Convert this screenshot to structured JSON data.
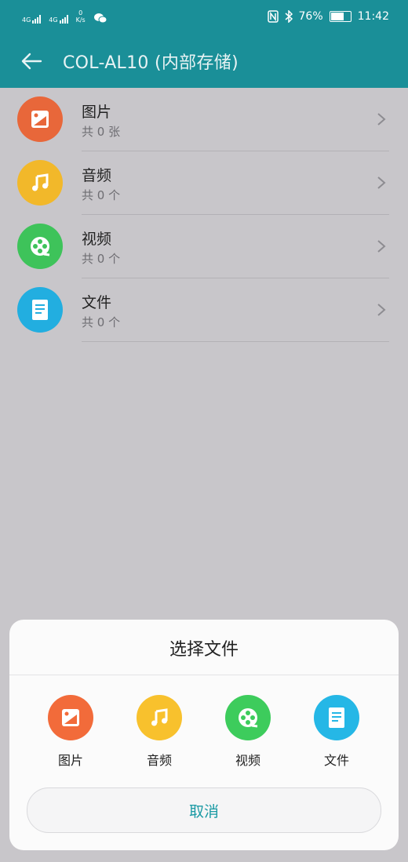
{
  "status_bar": {
    "signal1_label": "4G",
    "signal2_label": "4G",
    "net_speed_value": "0",
    "net_speed_unit": "K/s",
    "battery_percent": 76,
    "battery_text": "76%",
    "time": "11:42"
  },
  "app_bar": {
    "title": "COL-AL10 (内部存储)"
  },
  "list": {
    "items": [
      {
        "title": "图片",
        "subtitle": "共 0 张",
        "icon": "image-icon",
        "color": "#e8673a"
      },
      {
        "title": "音频",
        "subtitle": "共 0 个",
        "icon": "music-icon",
        "color": "#f2b82a"
      },
      {
        "title": "视频",
        "subtitle": "共 0 个",
        "icon": "video-icon",
        "color": "#3ec35a"
      },
      {
        "title": "文件",
        "subtitle": "共 0 个",
        "icon": "document-icon",
        "color": "#22aee0"
      }
    ]
  },
  "sheet": {
    "title": "选择文件",
    "options": [
      {
        "label": "图片",
        "icon": "image-icon",
        "color": "#f26b3a"
      },
      {
        "label": "音频",
        "icon": "music-icon",
        "color": "#f8c12d"
      },
      {
        "label": "视频",
        "icon": "video-icon",
        "color": "#3dcc5c"
      },
      {
        "label": "文件",
        "icon": "document-icon",
        "color": "#25b7e6"
      }
    ],
    "cancel_label": "取消"
  }
}
